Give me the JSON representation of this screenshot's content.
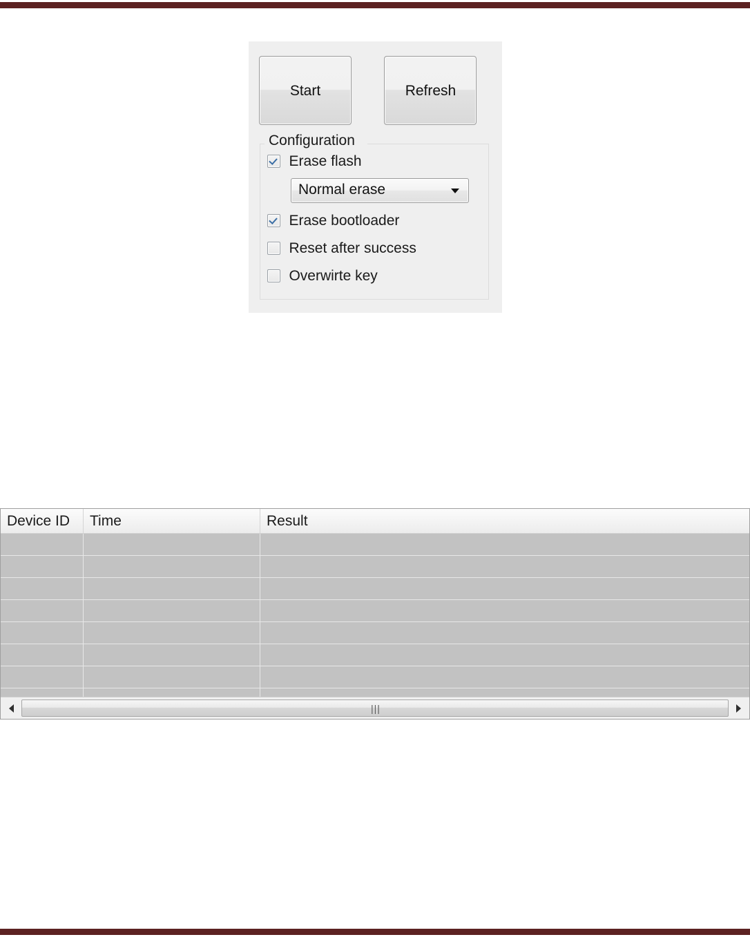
{
  "page": {
    "rule_color": "#5c2222",
    "background": "#ffffff"
  },
  "control_panel": {
    "background": "#efefef",
    "buttons": [
      {
        "name": "start-button",
        "label": "Start"
      },
      {
        "name": "refresh-button",
        "label": "Refresh"
      }
    ],
    "configuration": {
      "legend": "Configuration",
      "options": [
        {
          "name": "erase-flash",
          "label": "Erase flash",
          "checked": true
        },
        {
          "name": "erase-bootloader",
          "label": "Erase bootloader",
          "checked": true
        },
        {
          "name": "reset-after",
          "label": "Reset after success",
          "checked": false
        },
        {
          "name": "overwrite-key",
          "label": "Overwirte key",
          "checked": false
        }
      ],
      "erase_mode": {
        "selected": "Normal erase",
        "arrow_icon": "chevron-down-icon"
      }
    }
  },
  "results_table": {
    "columns": [
      {
        "key": "device_id",
        "label": "Device ID"
      },
      {
        "key": "time",
        "label": "Time"
      },
      {
        "key": "result",
        "label": "Result"
      }
    ],
    "rows": [
      {
        "device_id": "",
        "time": "",
        "result": ""
      },
      {
        "device_id": "",
        "time": "",
        "result": ""
      },
      {
        "device_id": "",
        "time": "",
        "result": ""
      },
      {
        "device_id": "",
        "time": "",
        "result": ""
      },
      {
        "device_id": "",
        "time": "",
        "result": ""
      },
      {
        "device_id": "",
        "time": "",
        "result": ""
      },
      {
        "device_id": "",
        "time": "",
        "result": ""
      },
      {
        "device_id": "",
        "time": "",
        "result": ""
      }
    ],
    "row_background": "#c2c2c2",
    "scrollbar": {
      "left_arrow_icon": "triangle-left-icon",
      "right_arrow_icon": "triangle-right-icon",
      "thumb_grip": "|||"
    }
  }
}
